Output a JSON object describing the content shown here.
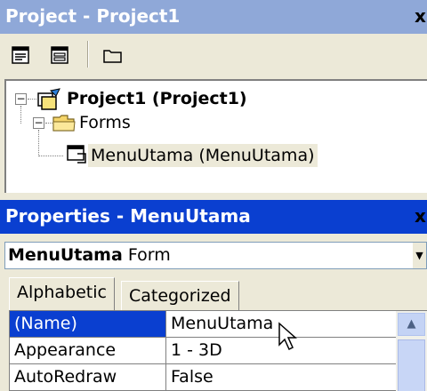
{
  "project_window": {
    "title": "Project - Project1",
    "close_label": "x",
    "toolbar": {
      "view_code": "view-code-icon",
      "view_object": "view-object-icon",
      "toggle_folders": "folder-icon"
    },
    "tree": {
      "root": "Project1 (Project1)",
      "folder": "Forms",
      "item": "MenuUtama (MenuUtama)"
    }
  },
  "properties_window": {
    "title": "Properties - MenuUtama",
    "close_label": "x",
    "object": {
      "name": "MenuUtama",
      "type": "Form"
    },
    "tabs": [
      {
        "label": "Alphabetic",
        "active": true
      },
      {
        "label": "Categorized",
        "active": false
      }
    ],
    "rows": [
      {
        "name": "(Name)",
        "value": "MenuUtama",
        "selected": true
      },
      {
        "name": "Appearance",
        "value": "1 - 3D",
        "selected": false
      },
      {
        "name": "AutoRedraw",
        "value": "False",
        "selected": false
      }
    ]
  },
  "colors": {
    "inactive_title": "#8fa8d8",
    "active_title": "#0a3fd0",
    "face": "#ece9d8"
  }
}
